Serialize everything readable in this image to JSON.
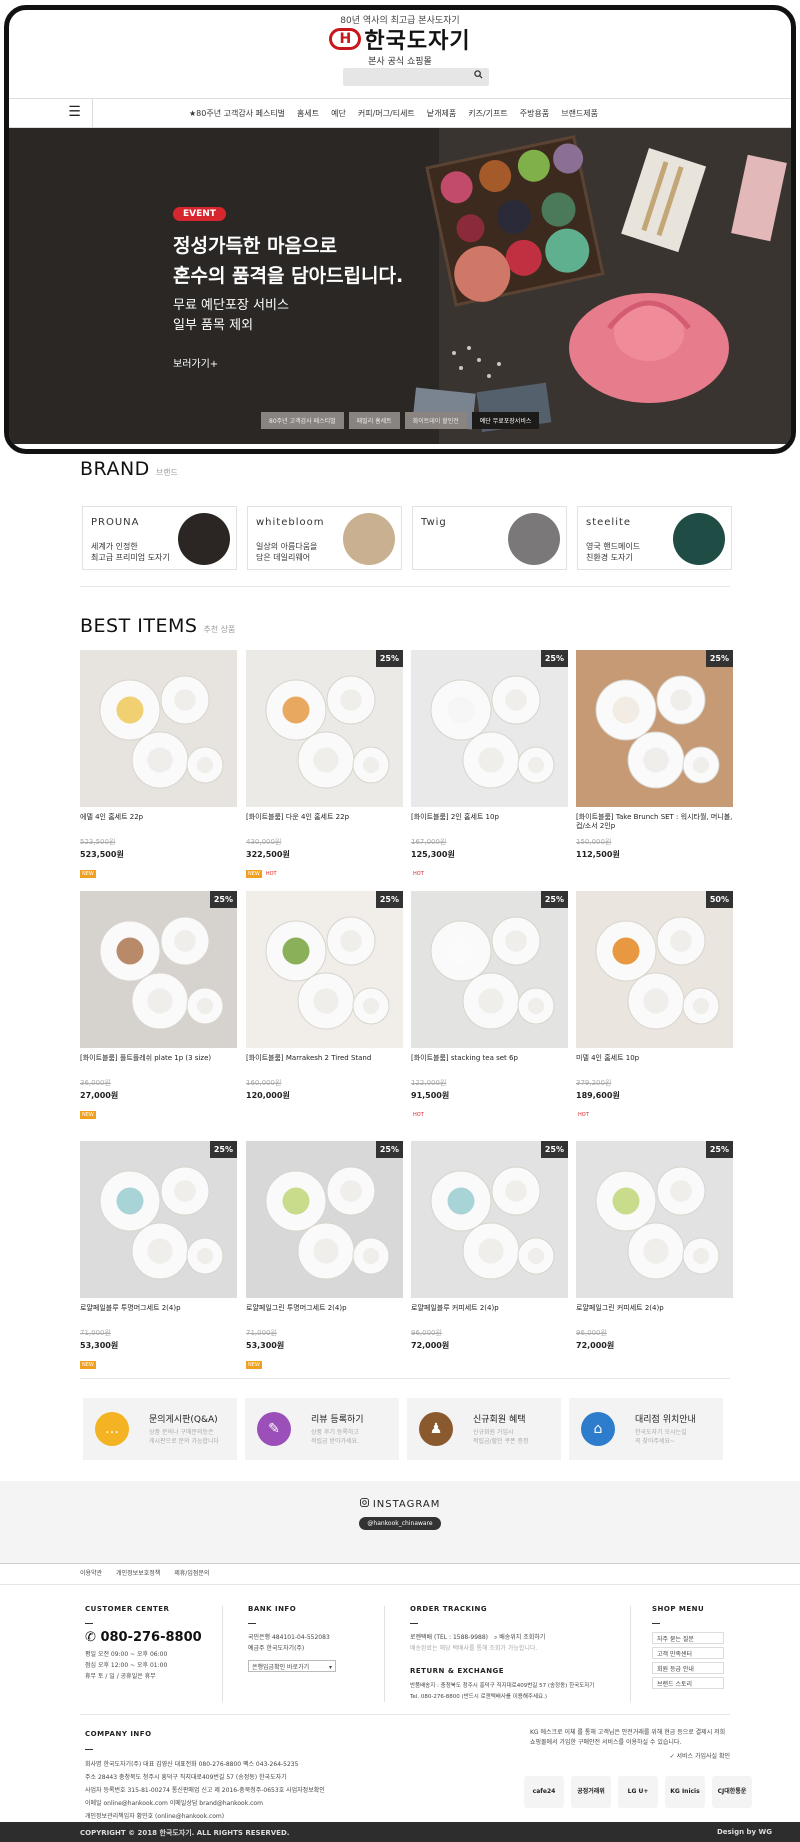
{
  "header": {
    "tagline": "80년 역사의 최고급 본사도자기",
    "logo_mark": "H",
    "logo_text": "한국도자기",
    "logo_sub": "본사 공식 쇼핑몰",
    "search_icon": "search-icon"
  },
  "nav": {
    "menu_icon": "☰",
    "items": [
      "★80주년 고객감사 페스티벌",
      "홈세트",
      "예단",
      "커피/머그/티세트",
      "낱개제품",
      "키즈/기프트",
      "주방용품",
      "브랜드제품"
    ]
  },
  "hero": {
    "badge": "EVENT",
    "line1": "정성가득한 마음으로",
    "line2": "혼수의 품격을 담아드립니다.",
    "line3": "무료 예단포장 서비스",
    "line4": "일부 품목 제외",
    "more": "보러가기+",
    "tabs": [
      "80주년 고객감사 페스티벌",
      "패밀리 홈세트",
      "화이트데이 할인전",
      "예단 무료포장서비스"
    ],
    "active_tab": 3
  },
  "brand": {
    "title": "BRAND",
    "subtitle": "브랜드",
    "cards": [
      {
        "logo": "PROUNA",
        "desc1": "세계가 인정한",
        "desc2": "최고급 프리미엄 도자기",
        "color": "#2b2623"
      },
      {
        "logo": "whitebloom",
        "desc1": "일상의 아름다움을",
        "desc2": "담은 데일리웨어",
        "color": "#c8b090"
      },
      {
        "logo": "Twig",
        "desc1": "",
        "desc2": "",
        "color": "#7a7878"
      },
      {
        "logo": "steelite",
        "desc1": "영국 핸드메이드",
        "desc2": "친환경 도자기",
        "color": "#1f4c44"
      }
    ]
  },
  "best": {
    "title": "BEST ITEMS",
    "subtitle": "추천 상품",
    "products": [
      {
        "name": "에델 4인 홈세트 22p",
        "old": "523,500원",
        "price": "523,500원",
        "discount": "",
        "tags": [
          "NEW"
        ],
        "bg": "#e7e4df",
        "accent": "#f0d070"
      },
      {
        "name": "[화이트블룸] 다운 4인 홈세트 22p",
        "old": "430,000원",
        "price": "322,500원",
        "discount": "25%",
        "tags": [
          "NEW",
          "HOT"
        ],
        "bg": "#eceae6",
        "accent": "#e8a860"
      },
      {
        "name": "[화이트블룸] 2인 홈세트 10p",
        "old": "167,000원",
        "price": "125,300원",
        "discount": "25%",
        "tags": [
          "HOT"
        ],
        "bg": "#e9e9e9",
        "accent": "#f6f6f6"
      },
      {
        "name": "[화이트블룸] Take Brunch SET : 워시타월, 머니볼, 컵/소서 2인p",
        "old": "150,000원",
        "price": "112,500원",
        "discount": "25%",
        "tags": [],
        "bg": "#c69a74",
        "accent": "#f2ece4"
      },
      {
        "name": "[화이트블룸] 플트플레쉬 plate 1p (3 size)",
        "old": "36,000원",
        "price": "27,000원",
        "discount": "25%",
        "tags": [
          "NEW"
        ],
        "bg": "#d6d3cf",
        "accent": "#b98a6a"
      },
      {
        "name": "[화이트블룸] Marrakesh 2 Tired Stand",
        "old": "160,000원",
        "price": "120,000원",
        "discount": "25%",
        "tags": [],
        "bg": "#f1eeea",
        "accent": "#8bb05a"
      },
      {
        "name": "[화이트블룸] stacking tea set 6p",
        "old": "122,000원",
        "price": "91,500원",
        "discount": "25%",
        "tags": [
          "HOT"
        ],
        "bg": "#e3e3e2",
        "accent": "#fbfbfb"
      },
      {
        "name": "미델 4인 홈세트 10p",
        "old": "379,200원",
        "price": "189,600원",
        "discount": "50%",
        "tags": [
          "HOT"
        ],
        "bg": "#eae6df",
        "accent": "#e89840"
      },
      {
        "name": "로얄페일블루 투명머그세트 2(4)p",
        "old": "71,000원",
        "price": "53,300원",
        "discount": "25%",
        "tags": [
          "NEW"
        ],
        "bg": "#dcdcdc",
        "accent": "#a8d4d8"
      },
      {
        "name": "로얄페일그린 투명머그세트 2(4)p",
        "old": "71,000원",
        "price": "53,300원",
        "discount": "25%",
        "tags": [
          "NEW"
        ],
        "bg": "#d8d8d8",
        "accent": "#c8dc8c"
      },
      {
        "name": "로얄페일블루 커피세트 2(4)p",
        "old": "96,000원",
        "price": "72,000원",
        "discount": "25%",
        "tags": [],
        "bg": "#e2e2e2",
        "accent": "#a8d4d8"
      },
      {
        "name": "로얄페일그린 커피세트 2(4)p",
        "old": "96,000원",
        "price": "72,000원",
        "discount": "25%",
        "tags": [],
        "bg": "#e2e2e2",
        "accent": "#c8dc8c"
      }
    ]
  },
  "services": [
    {
      "title": "문의게시판(Q&A)",
      "desc1": "상품 문의나 구매문의등은",
      "desc2": "게시판으로 문의 가능합니다",
      "color": "#f3b323",
      "glyph": "…",
      "icon": "chat-icon"
    },
    {
      "title": "리뷰 등록하기",
      "desc1": "상품 후기 등록하고",
      "desc2": "적립금 받아가세요.",
      "color": "#9b4fb8",
      "glyph": "✎",
      "icon": "pencil-icon"
    },
    {
      "title": "신규회원 혜택",
      "desc1": "신규회원 가입시",
      "desc2": "적립금/할인 쿠폰 증정",
      "color": "#8a5a2e",
      "glyph": "♟",
      "icon": "member-icon"
    },
    {
      "title": "대리점 위치안내",
      "desc1": "한국도자기 오시는길",
      "desc2": "꼭 찾아주세요~",
      "color": "#2e7ccc",
      "glyph": "⌂",
      "icon": "location-icon"
    }
  ],
  "instagram": {
    "icon": "instagram-icon",
    "title": "INSTAGRAM",
    "handle": "@hankook_chinaware"
  },
  "footer": {
    "links": [
      "이용약관",
      "개인정보보호정책",
      "제휴/입점문의"
    ],
    "customer": {
      "title": "CUSTOMER CENTER",
      "phone": "080-276-8800",
      "lines": [
        "평일   오전 09:00 ~ 오후 06:00",
        "점심   오후 12:00 ~ 오후 01:00",
        "휴무   토 / 일 / 공휴일은 휴무"
      ]
    },
    "bank": {
      "title": "BANK INFO",
      "lines": [
        "국민은행  484101-04-552083",
        "예금주  한국도자기(주)"
      ],
      "select": "은행입금확인 바로가기"
    },
    "order": {
      "title": "ORDER TRACKING",
      "line1": "로젠택배 (TEL : 1588-9988)",
      "btn": "배송위치 조회하기",
      "line2": "배송완료는 해당 택배사를 통해 조회가 가능합니다.",
      "ret_title": "RETURN & EXCHANGE",
      "ret1": "반품배송지 : 충청북도 청주시 흥덕구 직지대로409번길 57 (송정동) 한국도자기",
      "ret2": "Tel. 080-276-8800 (반드시 로젠택배사를 이용해주세요.)"
    },
    "shop": {
      "title": "SHOP MENU",
      "items": [
        "자주 묻는 질문",
        "고객 만족센터",
        "회원 등급 안내",
        "브랜드 스토리"
      ]
    },
    "company": {
      "title": "COMPANY INFO",
      "lines": [
        "회사명  한국도자기(주)     대표  김영신     대표전화  080-276-8800     팩스  043-264-5235",
        "주소  28443 충청북도 청주시 흥덕구 직지대로409번길 57 (송정동) 한국도자기",
        "사업자 등록번호  315-81-00274     통신판매업 신고  제 2016-충북청주-0653호     사업자정보확인",
        "이메일  online@hankook.com     이메일상담  brand@hankook.com",
        "개인정보관리책임자  황민호 (online@hankook.com)"
      ]
    },
    "escrow": "KG 에스크로 이체 를 통해 고객님은 안전거래를 위해 현금 등으로 결제시 저희 쇼핑몰에서 가입한 구매안전 서비스를 이용하실 수 있습니다.",
    "escrow_check": "서비스 가입사실 확인",
    "certs": [
      "cafe24",
      "공정거래위",
      "LG U+",
      "KG Inicis",
      "CJ대한통운"
    ],
    "copyright": "COPYRIGHT © 2018 한국도자기. ALL RIGHTS RESERVED.",
    "design": "Design by WG"
  }
}
